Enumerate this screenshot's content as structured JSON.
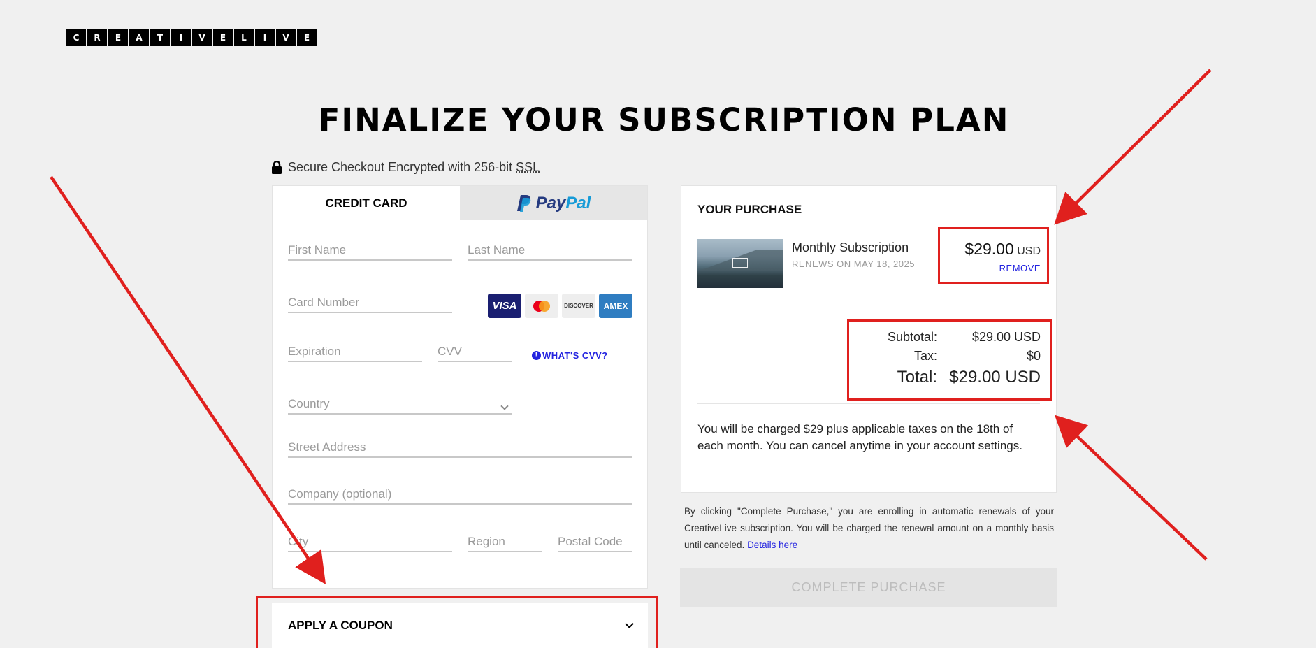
{
  "logo": {
    "letters": [
      "C",
      "R",
      "E",
      "A",
      "T",
      "I",
      "V",
      "E",
      "L",
      "I",
      "V",
      "E"
    ]
  },
  "page_title": "FINALIZE YOUR SUBSCRIPTION PLAN",
  "secure": {
    "text": "Secure Checkout Encrypted with 256-bit ",
    "ssl": "SSL"
  },
  "tabs": {
    "credit_card": "CREDIT CARD",
    "paypal_pay": "Pay",
    "paypal_pal": "Pal"
  },
  "form": {
    "first_name": "First Name",
    "last_name": "Last Name",
    "card_number": "Card Number",
    "expiration": "Expiration",
    "cvv": "CVV",
    "whats_cvv": "WHAT'S CVV?",
    "country": "Country",
    "street": "Street Address",
    "company": "Company (optional)",
    "city": "City",
    "region": "Region",
    "postal": "Postal Code",
    "card_brands": {
      "visa": "VISA",
      "discover": "DISCOVER",
      "amex": "AMEX"
    }
  },
  "coupon": {
    "label": "APPLY A COUPON"
  },
  "purchase": {
    "heading": "YOUR PURCHASE",
    "item_title": "Monthly Subscription",
    "item_renews": "RENEWS ON MAY 18, 2025",
    "price": "$29.00",
    "currency": "USD",
    "remove": "REMOVE",
    "subtotal_label": "Subtotal:",
    "subtotal_value": "$29.00 USD",
    "tax_label": "Tax:",
    "tax_value": "$0",
    "total_label": "Total:",
    "total_value": "$29.00 USD",
    "charge_note": "You will be charged $29 plus applicable taxes on the 18th of each month. You can cancel anytime in your account settings."
  },
  "fine_print": {
    "text": "By clicking \"Complete Purchase,\" you are enrolling in automatic renewals of your CreativeLive subscription. You will be charged the renewal amount on a monthly basis until canceled. ",
    "link": "Details here"
  },
  "complete_button": "COMPLETE PURCHASE",
  "colors": {
    "annotation": "#e0201e",
    "link": "#2323e0",
    "background": "#f0f0f0"
  }
}
